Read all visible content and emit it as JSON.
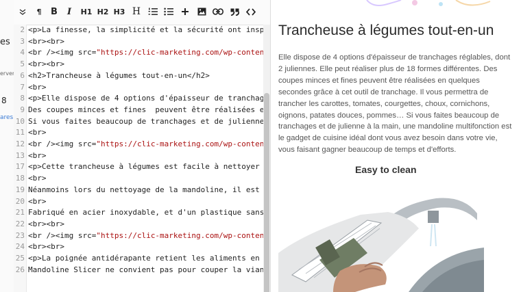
{
  "sidebar_strip": {
    "text_1": "es",
    "text_2": "erver",
    "text_3": "8",
    "text_4": "ares"
  },
  "toolbar": {
    "items": [
      {
        "label": "",
        "icon": "chevron-down-icon"
      },
      {
        "label": "¶",
        "icon": "paragraph-icon"
      },
      {
        "label": "B",
        "icon": "bold-icon"
      },
      {
        "label": "I",
        "icon": "italic-icon"
      },
      {
        "label": "H1",
        "icon": "heading1-icon"
      },
      {
        "label": "H2",
        "icon": "heading2-icon"
      },
      {
        "label": "H3",
        "icon": "heading3-icon"
      },
      {
        "label": "H",
        "icon": "heading-icon"
      },
      {
        "label": "",
        "icon": "ordered-list-icon"
      },
      {
        "label": "",
        "icon": "unordered-list-icon"
      },
      {
        "label": "",
        "icon": "plus-icon"
      },
      {
        "label": "",
        "icon": "image-icon"
      },
      {
        "label": "",
        "icon": "link-icon"
      },
      {
        "label": "",
        "icon": "quote-icon"
      },
      {
        "label": "",
        "icon": "code-icon"
      }
    ]
  },
  "editor": {
    "lines": [
      {
        "n": "2",
        "text": "<p>La finesse, la simplicité et la sécurité ont inspiré la concep"
      },
      {
        "n": "3",
        "text": "<br><br>"
      },
      {
        "n": "4",
        "pre": "<br /><img src=",
        "str": "\"https://clic-marketing.com/wp-content/uploads/2020"
      },
      {
        "n": "5",
        "text": "<br><br>"
      },
      {
        "n": "6",
        "text": "<h2>Trancheuse à légumes tout-en-un</h2>"
      },
      {
        "n": "7",
        "text": "<br>"
      },
      {
        "n": "8",
        "text": "<p>Elle dispose de 4 options d'épaisseur de tranchages réglables,"
      },
      {
        "n": "9",
        "text": "Des coupes minces et fines  peuvent être réalisées en quelques sec"
      },
      {
        "n": "10",
        "text": "Si vous faites beaucoup de tranchages et de julienne à la main, un"
      },
      {
        "n": "11",
        "text": "<br>"
      },
      {
        "n": "12",
        "pre": "<br /><img src=",
        "str": "\"https://clic-marketing.com/wp-content/uploads/2020"
      },
      {
        "n": "13",
        "text": "<br>"
      },
      {
        "n": "17",
        "text": "<p>Cette trancheuse à légumes est facile à nettoyer sous l'eau ou"
      },
      {
        "n": "18",
        "text": "<br>"
      },
      {
        "n": "19",
        "text": "Néanmoins lors du nettoyage de la mandoline, il est strictement in"
      },
      {
        "n": "20",
        "text": "<br>"
      },
      {
        "n": "21",
        "text": "Fabriqué en acier inoxydable, et d'un plastique sans BPA de haute"
      },
      {
        "n": "22",
        "text": "<br><br>"
      },
      {
        "n": "23",
        "pre": "<br /><img src=",
        "str": "\"https://clic-marketing.com/wp-content/uploads/2020"
      },
      {
        "n": "24",
        "text": "<br><br>"
      },
      {
        "n": "25",
        "text": "<p>La poignée antidérapante retient les aliments en toute sécurité"
      },
      {
        "n": "26",
        "text": "Mandoline Slicer ne convient pas pour couper la viande.</p>"
      }
    ]
  },
  "preview": {
    "title": "Trancheuse à légumes tout-en-un",
    "body": "Elle dispose de 4 options d'épaisseur de tranchages réglables, dont 2 juliennes. Elle peut réaliser plus de 18 formes différentes. Des coupes minces et fines peuvent être réalisées en quelques secondes grâce à cet outil de tranchage. Il vous permettra de trancher les carottes, tomates, courgettes, choux, cornichons, oignons, patates douces, pommes… Si vous faites beaucoup de tranchages et de julienne à la main, une mandoline multifonction est le gadget de cuisine idéal dont vous avez besoin dans votre vie, vous faisant gagner beaucoup de temps et d'efforts.",
    "image_caption": "Easy to clean"
  }
}
